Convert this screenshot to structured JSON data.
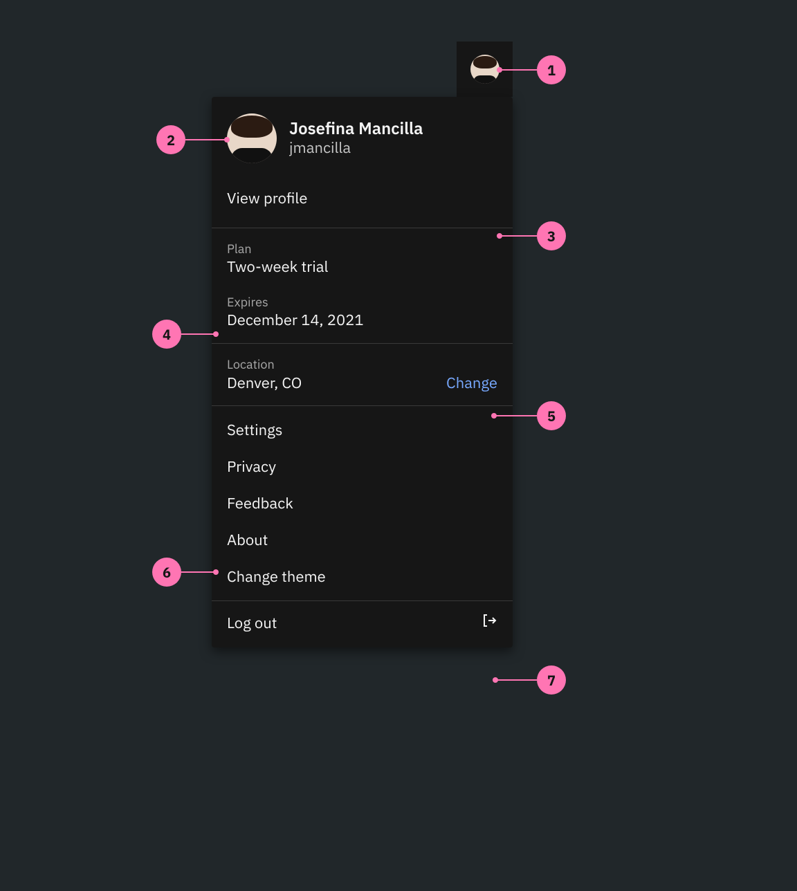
{
  "user": {
    "name": "Josefina Mancilla",
    "username": "jmancilla"
  },
  "links": {
    "view_profile": "View profile",
    "change": "Change"
  },
  "plan": {
    "label": "Plan",
    "value": "Two-week trial"
  },
  "expires": {
    "label": "Expires",
    "value": "December 14, 2021"
  },
  "location": {
    "label": "Location",
    "value": "Denver, CO"
  },
  "menu": {
    "settings": "Settings",
    "privacy": "Privacy",
    "feedback": "Feedback",
    "about": "About",
    "change_theme": "Change theme",
    "log_out": "Log out"
  },
  "annotations": {
    "1": "1",
    "2": "2",
    "3": "3",
    "4": "4",
    "5": "5",
    "6": "6",
    "7": "7"
  }
}
